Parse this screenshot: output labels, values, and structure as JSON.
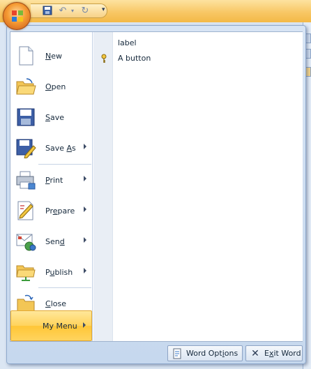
{
  "menu": {
    "items": [
      {
        "label": "New",
        "mnemonic": "N",
        "rest": "ew",
        "icon": "new-document-icon",
        "submenu": false
      },
      {
        "label": "Open",
        "mnemonic": "O",
        "rest": "pen",
        "icon": "open-folder-icon",
        "submenu": false
      },
      {
        "label": "Save",
        "mnemonic": "S",
        "rest": "ave",
        "icon": "save-disk-icon",
        "submenu": false
      },
      {
        "label": "Save As",
        "pre": "Save ",
        "mnemonic": "A",
        "rest": "s",
        "icon": "save-as-icon",
        "submenu": true
      },
      {
        "label": "Print",
        "mnemonic": "P",
        "rest": "rint",
        "icon": "printer-icon",
        "submenu": true
      },
      {
        "label": "Prepare",
        "pre": "Pr",
        "mnemonic": "e",
        "rest": "pare",
        "icon": "prepare-pencil-icon",
        "submenu": true
      },
      {
        "label": "Send",
        "pre": "Sen",
        "mnemonic": "d",
        "rest": "",
        "icon": "send-mail-icon",
        "submenu": true
      },
      {
        "label": "Publish",
        "mnemonic": "u",
        "pre": "P",
        "rest": "blish",
        "icon": "publish-folder-icon",
        "submenu": true
      },
      {
        "label": "Close",
        "mnemonic": "C",
        "rest": "lose",
        "icon": "close-folder-icon",
        "submenu": false
      },
      {
        "label": "My Menu",
        "icon": "none",
        "submenu": true,
        "selected": true
      }
    ],
    "submenu_items": [
      {
        "label": "label",
        "icon": "none"
      },
      {
        "label": "A button",
        "icon": "key-icon"
      }
    ],
    "bottom_buttons": {
      "word_options": {
        "pre": "Word Opt",
        "mnemonic": "i",
        "rest": "ons",
        "label": "Word Options"
      },
      "exit_word": {
        "pre": "",
        "mnemonic": "x",
        "first": "E",
        "rest": "it Word",
        "label": "Exit Word"
      }
    }
  },
  "colors": {
    "accent_selected": "#ffd35c",
    "menu_background": "#d7e4f4",
    "text": "#15283b"
  }
}
